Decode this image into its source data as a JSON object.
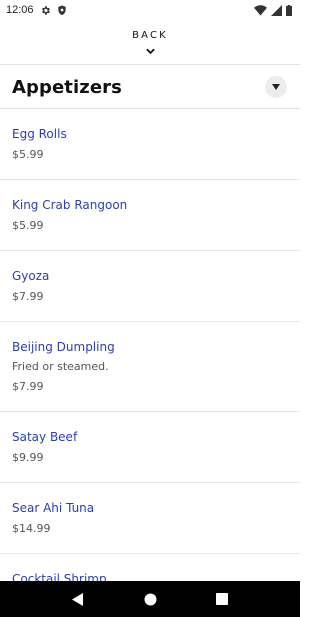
{
  "status_bar": {
    "time": "12:06",
    "icons": [
      "gear-icon",
      "shield-icon",
      "wifi-icon",
      "signal-icon",
      "battery-icon"
    ]
  },
  "nav": {
    "back_label": "BACK"
  },
  "section": {
    "title": "Appetizers"
  },
  "menu_items": [
    {
      "name": "Egg Rolls",
      "description": "",
      "price": "$5.99"
    },
    {
      "name": "King Crab Rangoon",
      "description": "",
      "price": "$5.99"
    },
    {
      "name": "Gyoza",
      "description": "",
      "price": "$7.99"
    },
    {
      "name": "Beijing Dumpling",
      "description": "Fried or steamed.",
      "price": "$7.99"
    },
    {
      "name": "Satay Beef",
      "description": "",
      "price": "$9.99"
    },
    {
      "name": "Sear Ahi Tuna",
      "description": "",
      "price": "$14.99"
    },
    {
      "name": "Cocktail Shrimp",
      "description": "",
      "price": ""
    }
  ],
  "colors": {
    "item_name": "#2b3fb0",
    "price": "#555555",
    "divider": "#e4e4e4",
    "nav_bar": "#000000"
  }
}
